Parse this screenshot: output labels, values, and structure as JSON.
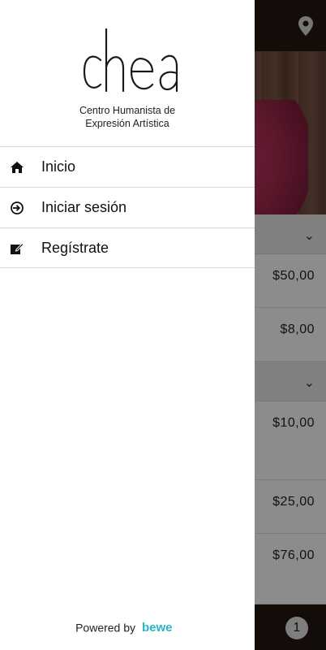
{
  "drawer": {
    "logo": {
      "wordmark": "chea",
      "subtitle_line1": "Centro Humanista de",
      "subtitle_line2": "Expresión Artística"
    },
    "menu": [
      {
        "label": "Inicio",
        "icon": "home-icon"
      },
      {
        "label": "Iniciar sesión",
        "icon": "login-icon"
      },
      {
        "label": "Regístrate",
        "icon": "edit-icon"
      }
    ],
    "footer": {
      "powered_by": "Powered by",
      "brand": "bewe",
      "brand_color": "#2ab3c4"
    }
  },
  "background": {
    "prices": [
      "$50,00",
      "$8,00",
      "$10,00",
      "$25,00",
      "$76,00"
    ],
    "cart_count": "1",
    "colors": {
      "topbar": "#231712",
      "accent_fabric": "#b8305a"
    }
  }
}
